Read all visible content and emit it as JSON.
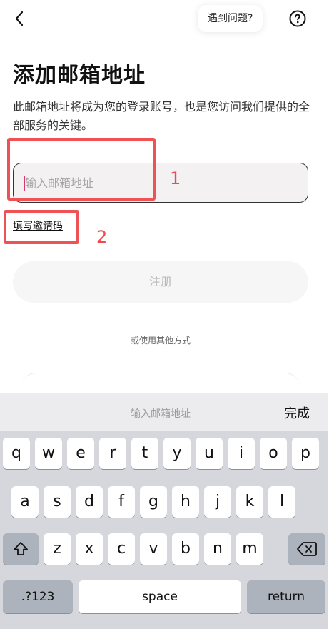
{
  "nav": {
    "help_text": "遇到问题?",
    "back_icon": "chevron-left-icon",
    "help_icon": "question-circle-icon"
  },
  "page": {
    "title": "添加邮箱地址",
    "description": "此邮箱地址将成为您的登录账号，也是您访问我们提供的全部服务的关键。"
  },
  "email_input": {
    "placeholder": "输入邮箱地址",
    "value": ""
  },
  "invite_link": "填写邀请码",
  "register_label": "注册",
  "other_methods_label": "或使用其他方式",
  "annotations": {
    "box1_label": "1",
    "box2_label": "2",
    "color": "#ef5254"
  },
  "keyboard": {
    "accessory_placeholder": "输入邮箱地址",
    "done_label": "完成",
    "row1": [
      "q",
      "w",
      "e",
      "r",
      "t",
      "y",
      "u",
      "i",
      "o",
      "p"
    ],
    "row2": [
      "a",
      "s",
      "d",
      "f",
      "g",
      "h",
      "j",
      "k",
      "l"
    ],
    "row3": [
      "z",
      "x",
      "c",
      "v",
      "b",
      "n",
      "m"
    ],
    "numbers_label": ".?123",
    "space_label": "space",
    "return_label": "return",
    "shift_icon": "shift-icon",
    "delete_icon": "backspace-icon"
  }
}
